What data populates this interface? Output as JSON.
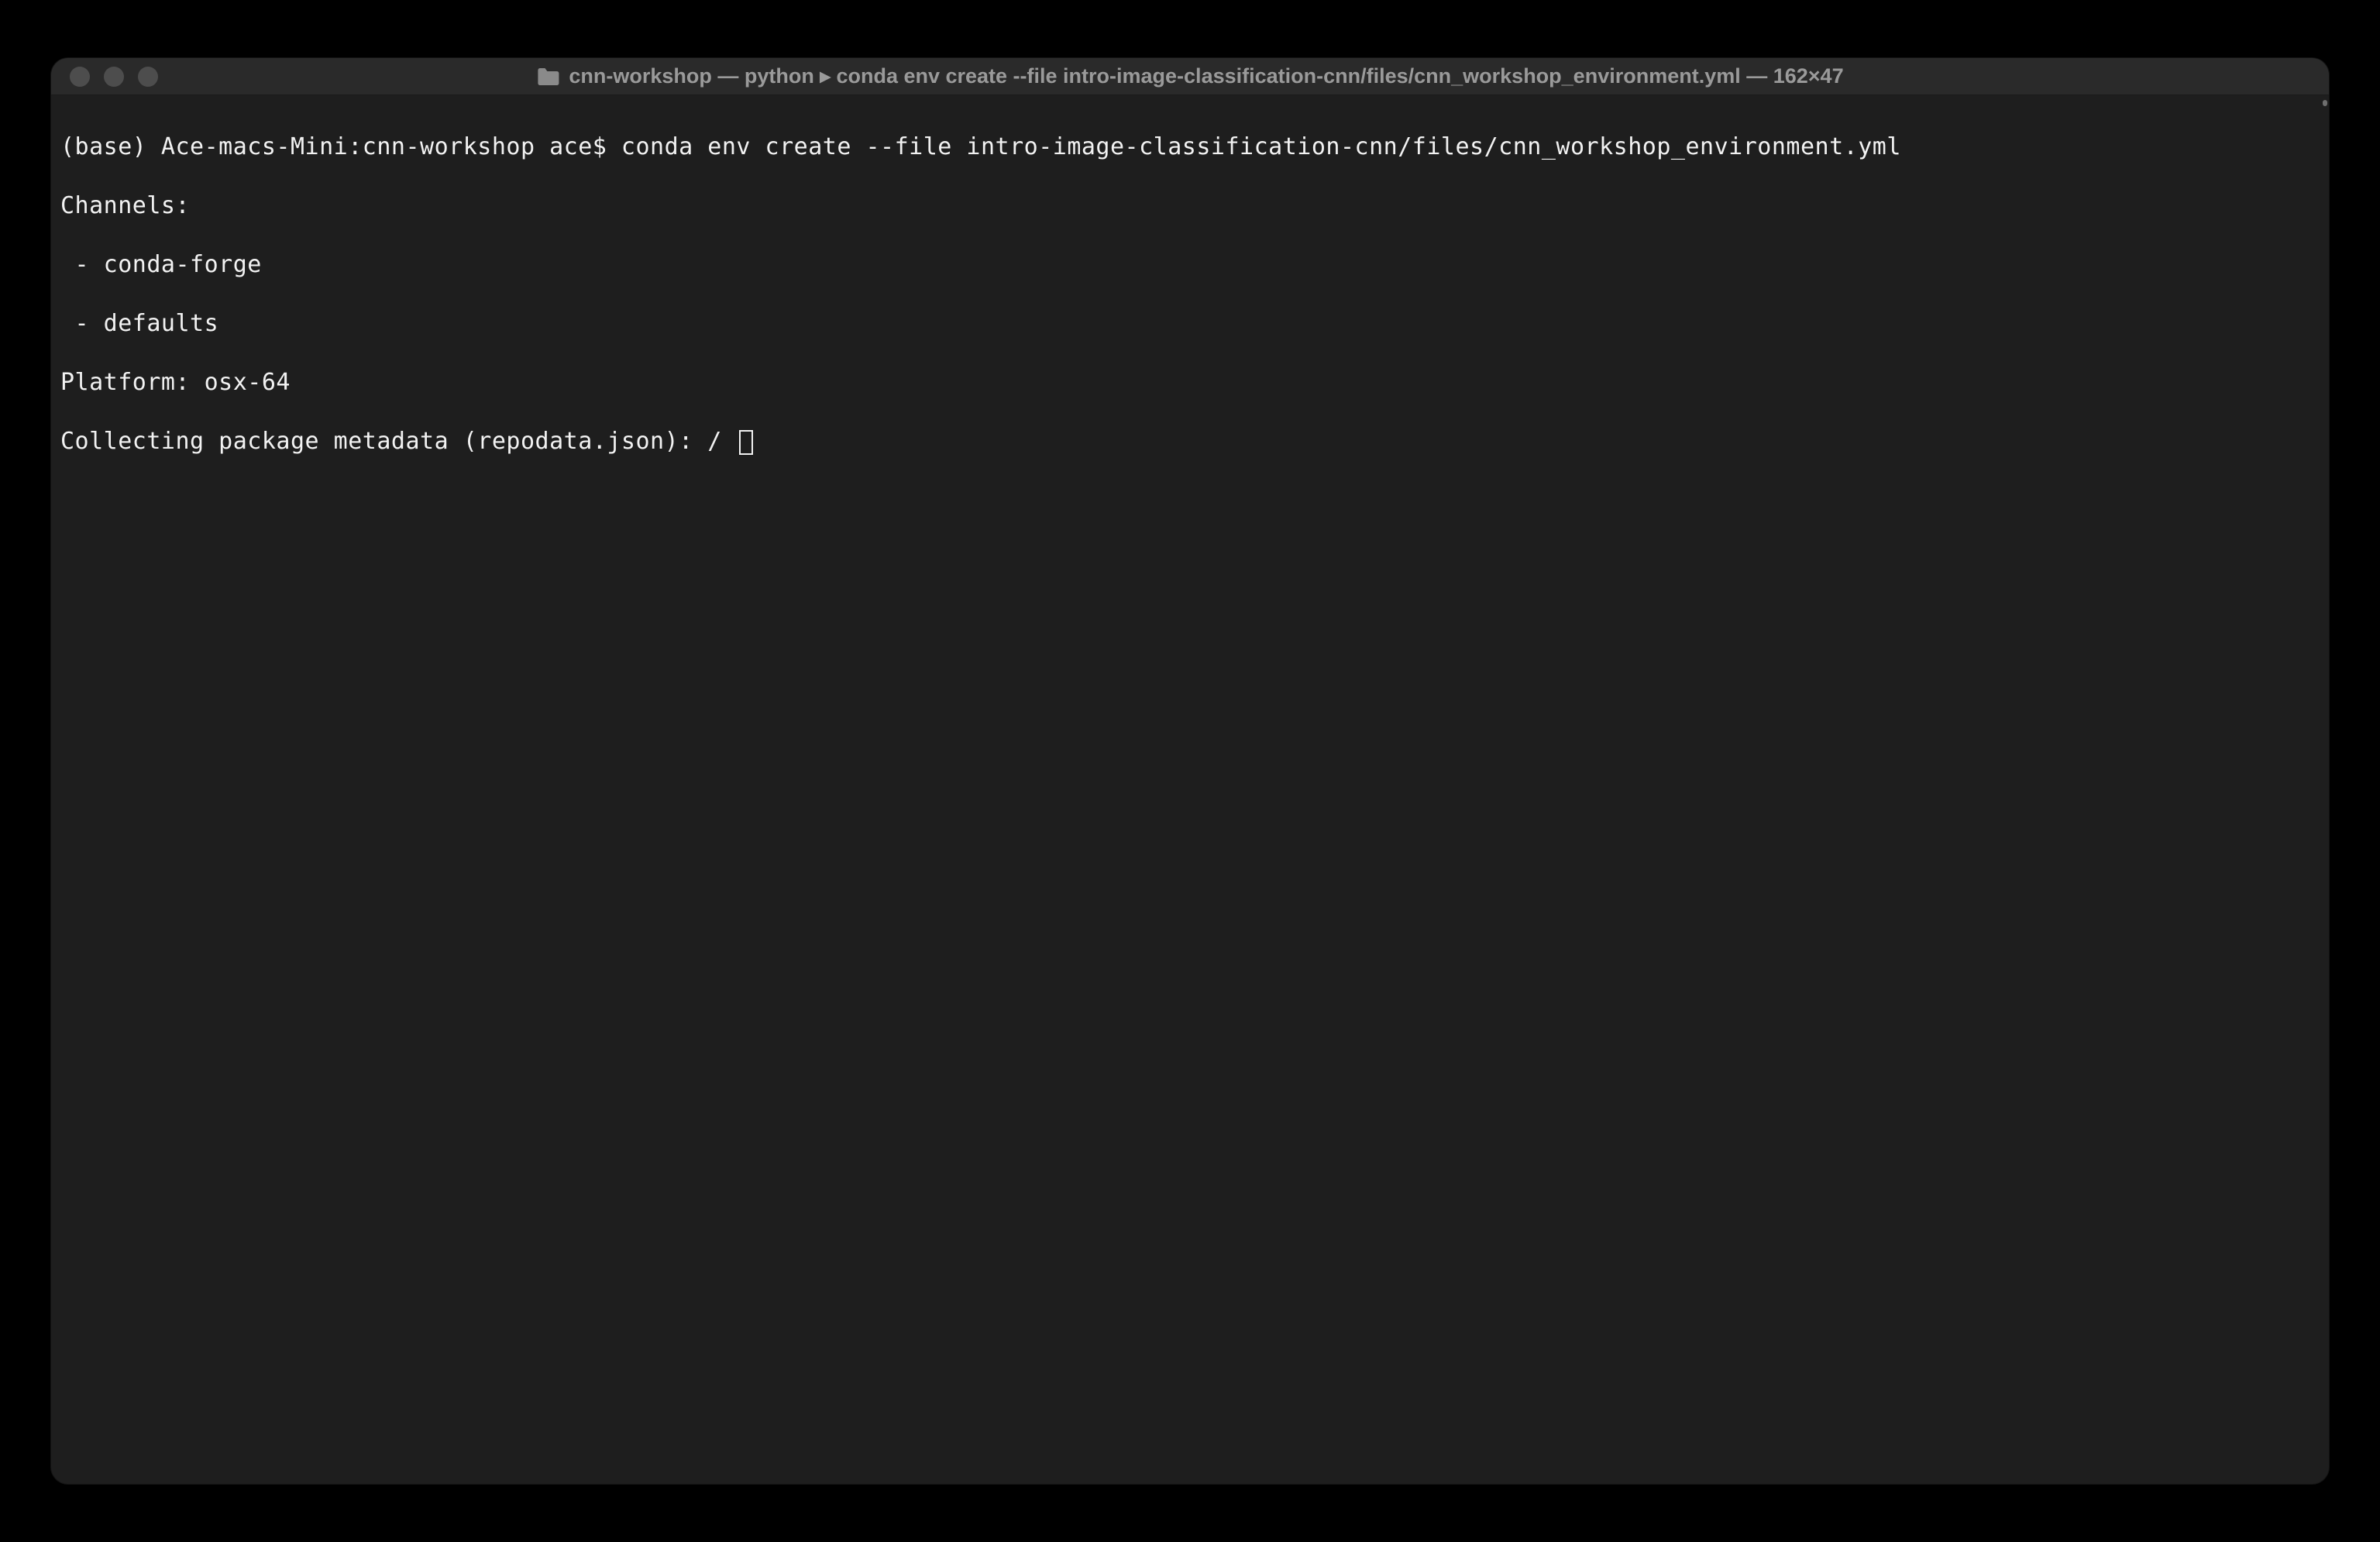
{
  "window": {
    "title": "cnn-workshop — python ▸ conda env create --file intro-image-classification-cnn/files/cnn_workshop_environment.yml — 162×47"
  },
  "terminal": {
    "prompt": "(base) Ace-macs-Mini:cnn-workshop ace$ ",
    "command": "conda env create --file intro-image-classification-cnn/files/cnn_workshop_environment.yml",
    "output_lines": [
      "Channels:",
      " - conda-forge",
      " - defaults",
      "Platform: osx-64",
      "Collecting package metadata (repodata.json): / "
    ]
  }
}
